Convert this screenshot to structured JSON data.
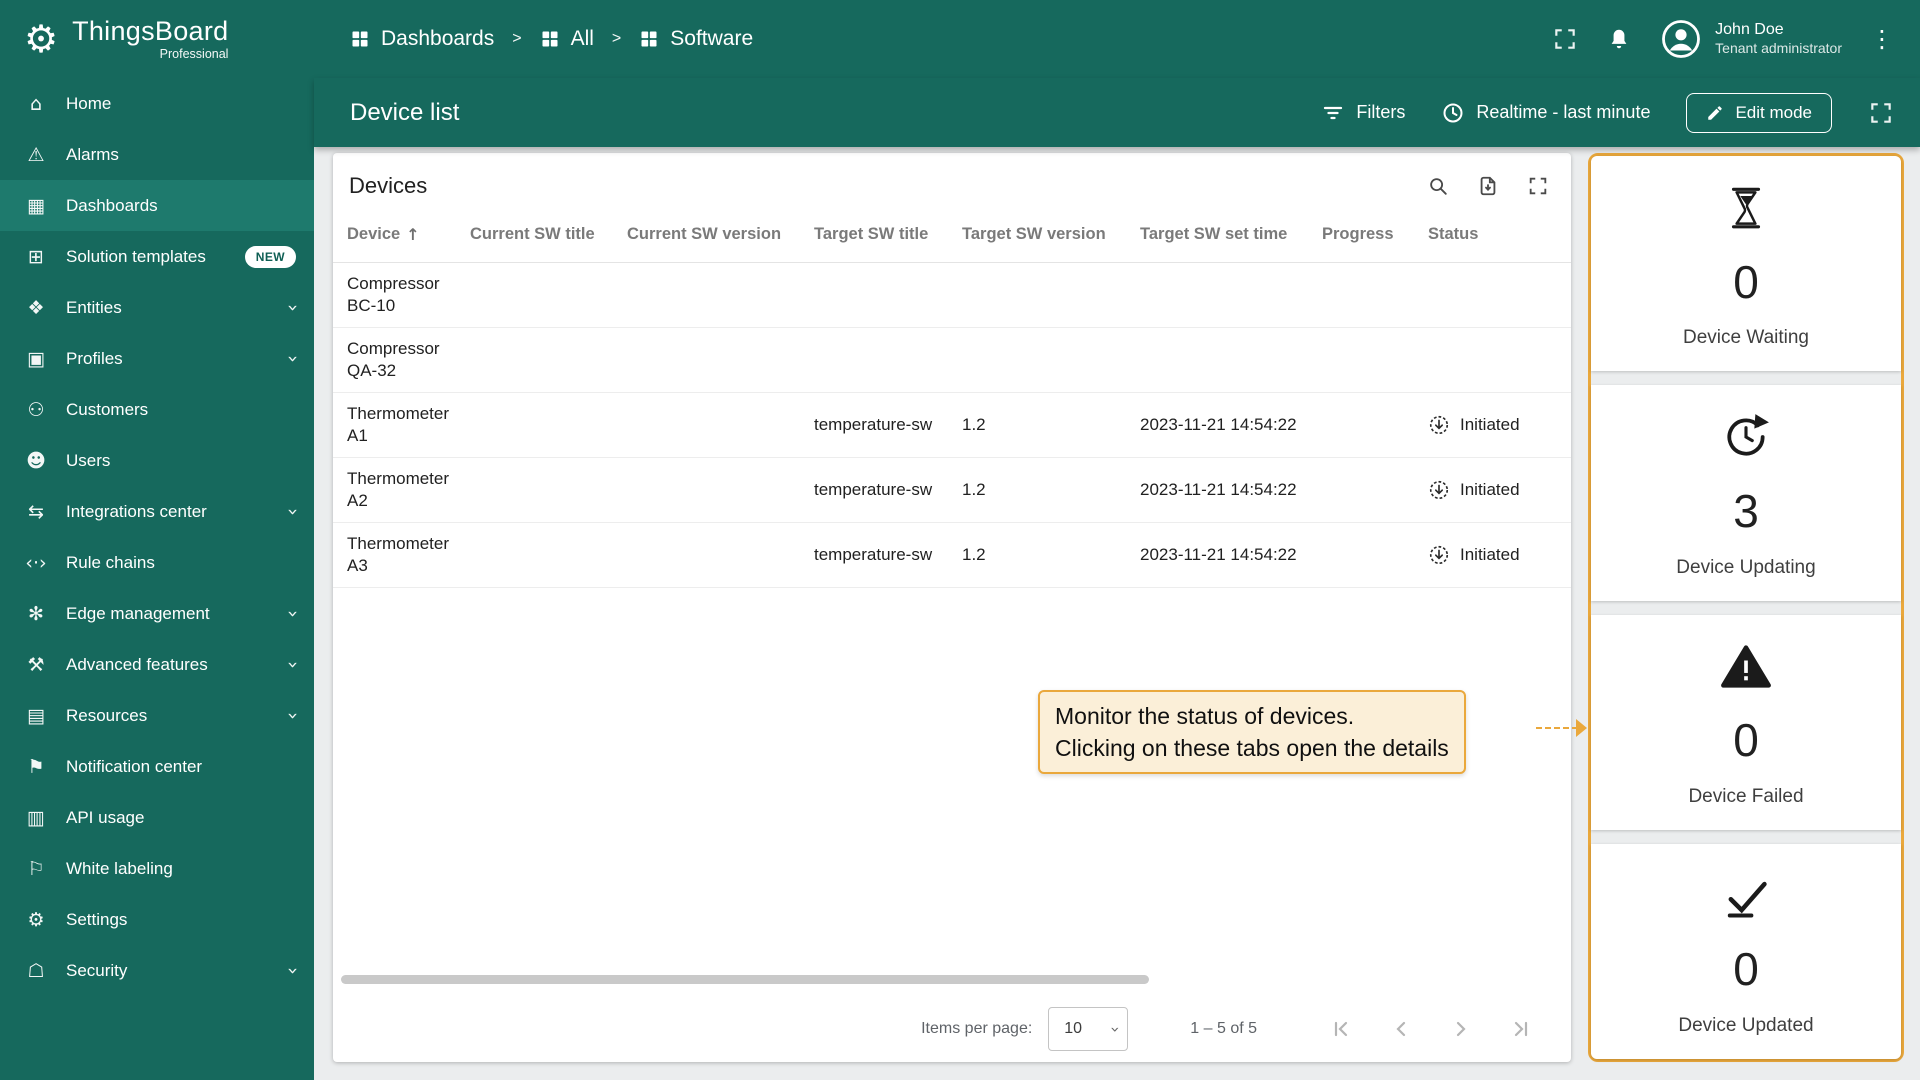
{
  "app": {
    "name": "ThingsBoard",
    "edition": "Professional"
  },
  "colors": {
    "primary_teal": "#16695D",
    "active_item": "#1E7A6D",
    "highlight_amber": "#EAA83C",
    "tooltip_bg": "#FBEFD8",
    "content_bg": "#EBEDEE"
  },
  "sidebar": {
    "items": [
      {
        "label": "Home",
        "icon": "home-icon",
        "glyph": "⌂"
      },
      {
        "label": "Alarms",
        "icon": "alarms-icon",
        "glyph": "⚠"
      },
      {
        "label": "Dashboards",
        "icon": "dashboards-icon",
        "glyph": "▦"
      },
      {
        "label": "Solution templates",
        "icon": "solution-templates-icon",
        "glyph": "⊞",
        "badge": "NEW"
      },
      {
        "label": "Entities",
        "icon": "entities-icon",
        "glyph": "❖"
      },
      {
        "label": "Profiles",
        "icon": "profiles-icon",
        "glyph": "▣"
      },
      {
        "label": "Customers",
        "icon": "customers-icon",
        "glyph": "⚇"
      },
      {
        "label": "Users",
        "icon": "users-icon",
        "glyph": "☻"
      },
      {
        "label": "Integrations center",
        "icon": "integrations-center-icon",
        "glyph": "⇆"
      },
      {
        "label": "Rule chains",
        "icon": "rule-chains-icon",
        "glyph": "‹·›"
      },
      {
        "label": "Edge management",
        "icon": "edge-management-icon",
        "glyph": "✻"
      },
      {
        "label": "Advanced features",
        "icon": "advanced-features-icon",
        "glyph": "⚒"
      },
      {
        "label": "Resources",
        "icon": "resources-icon",
        "glyph": "▤"
      },
      {
        "label": "Notification center",
        "icon": "notification-center-icon",
        "glyph": "⚑"
      },
      {
        "label": "API usage",
        "icon": "api-usage-icon",
        "glyph": "▥"
      },
      {
        "label": "White labeling",
        "icon": "white-labeling-icon",
        "glyph": "⚐"
      },
      {
        "label": "Settings",
        "icon": "settings-icon",
        "glyph": "⚙"
      },
      {
        "label": "Security",
        "icon": "security-icon",
        "glyph": "☖"
      }
    ]
  },
  "breadcrumb": {
    "separator": ">",
    "items": [
      {
        "label": "Dashboards"
      },
      {
        "label": "All"
      },
      {
        "label": "Software"
      }
    ]
  },
  "topbar": {
    "user_name": "John Doe",
    "user_role": "Tenant administrator",
    "kebab_glyph": "⋮"
  },
  "toolbar": {
    "title": "Device list",
    "filters_label": "Filters",
    "realtime_label": "Realtime - last minute",
    "edit_mode_label": "Edit mode"
  },
  "table": {
    "title": "Devices",
    "sort_arrow": "↑",
    "columns": [
      "Device",
      "Current SW title",
      "Current SW version",
      "Target SW title",
      "Target SW version",
      "Target SW set time",
      "Progress",
      "Status"
    ],
    "rows": [
      {
        "device_name": "Compressor",
        "device_id": "BC-10",
        "current_sw_title": "",
        "current_sw_version": "",
        "target_sw_title": "",
        "target_sw_version": "",
        "target_sw_set_time": "",
        "progress": "",
        "status": ""
      },
      {
        "device_name": "Compressor",
        "device_id": "QA-32",
        "current_sw_title": "",
        "current_sw_version": "",
        "target_sw_title": "",
        "target_sw_version": "",
        "target_sw_set_time": "",
        "progress": "",
        "status": ""
      },
      {
        "device_name": "Thermometer",
        "device_id": "A1",
        "current_sw_title": "",
        "current_sw_version": "",
        "target_sw_title": "temperature-sw",
        "target_sw_version": "1.2",
        "target_sw_set_time": "2023-11-21 14:54:22",
        "progress": "",
        "status": "Initiated"
      },
      {
        "device_name": "Thermometer",
        "device_id": "A2",
        "current_sw_title": "",
        "current_sw_version": "",
        "target_sw_title": "temperature-sw",
        "target_sw_version": "1.2",
        "target_sw_set_time": "2023-11-21 14:54:22",
        "progress": "",
        "status": "Initiated"
      },
      {
        "device_name": "Thermometer",
        "device_id": "A3",
        "current_sw_title": "",
        "current_sw_version": "",
        "target_sw_title": "temperature-sw",
        "target_sw_version": "1.2",
        "target_sw_set_time": "2023-11-21 14:54:22",
        "progress": "",
        "status": "Initiated"
      }
    ]
  },
  "pagination": {
    "items_per_page_label": "Items per page:",
    "items_per_page_value": "10",
    "range_label": "1 – 5 of 5"
  },
  "status_cards": [
    {
      "icon": "hourglass-icon",
      "value": "0",
      "label": "Device Waiting"
    },
    {
      "icon": "update-icon",
      "value": "3",
      "label": "Device Updating"
    },
    {
      "icon": "warning-icon",
      "value": "0",
      "label": "Device Failed"
    },
    {
      "icon": "check-icon",
      "value": "0",
      "label": "Device Updated"
    }
  ],
  "tooltip": {
    "line1": "Monitor the status of devices.",
    "line2": "Clicking on these tabs open the details"
  }
}
